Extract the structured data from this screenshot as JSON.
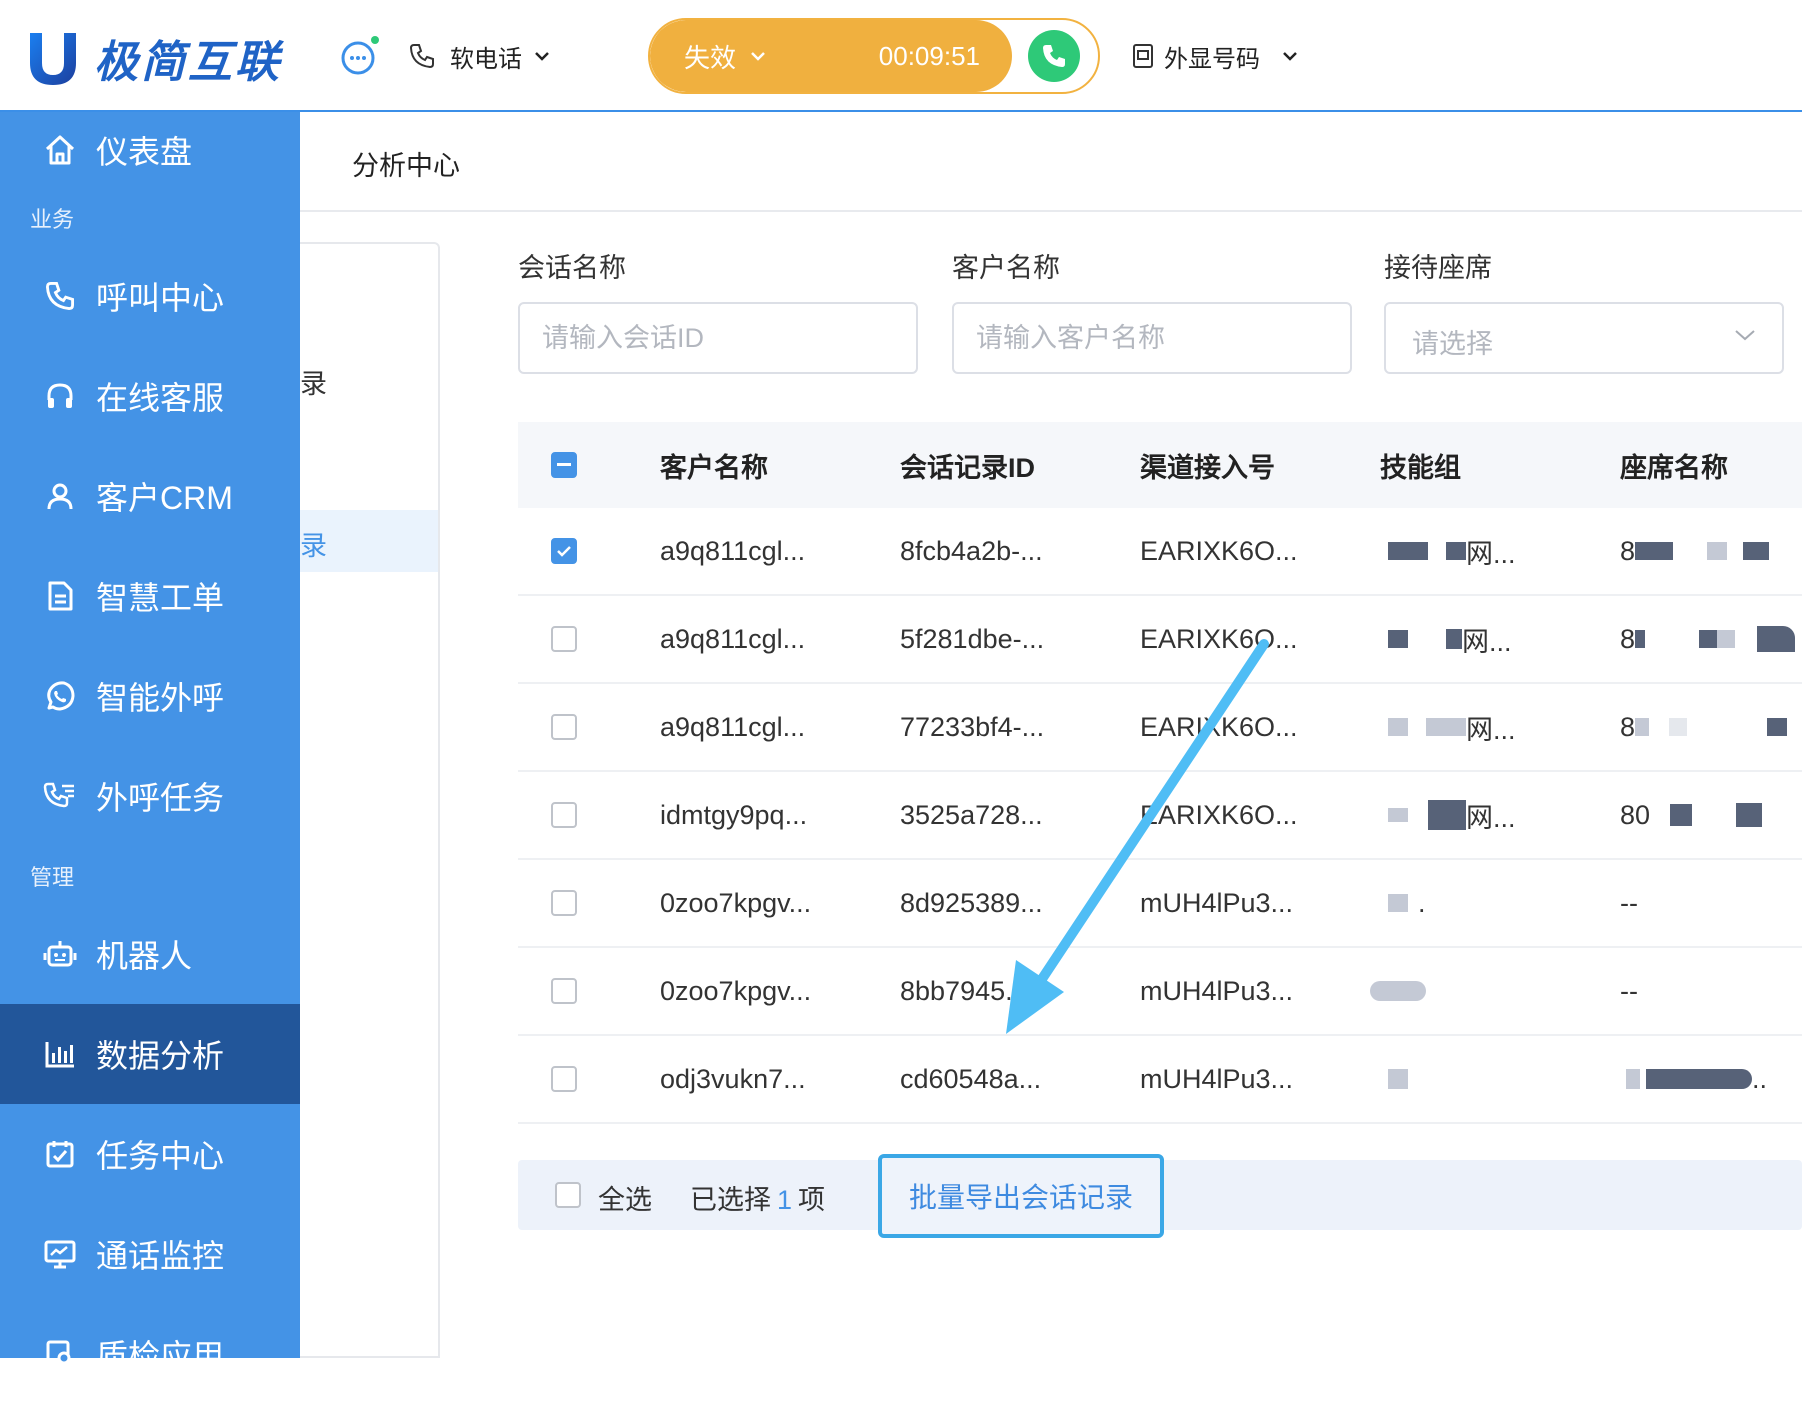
{
  "header": {
    "logo_text": "极简互联",
    "phone_mode": "软电话",
    "status": {
      "label": "失效",
      "timer": "00:09:51"
    },
    "caller_id": "外显号码"
  },
  "sidebar": {
    "top_item": {
      "label": "仪表盘",
      "icon": "home-icon"
    },
    "section_business": "业务",
    "business_items": [
      {
        "label": "呼叫中心",
        "icon": "phone-icon"
      },
      {
        "label": "在线客服",
        "icon": "headset-icon"
      },
      {
        "label": "客户CRM",
        "icon": "user-icon"
      },
      {
        "label": "智慧工单",
        "icon": "document-icon"
      },
      {
        "label": "智能外呼",
        "icon": "whatsapp-icon"
      },
      {
        "label": "外呼任务",
        "icon": "phone-list-icon"
      }
    ],
    "section_manage": "管理",
    "manage_items": [
      {
        "label": "机器人",
        "icon": "robot-icon"
      },
      {
        "label": "数据分析",
        "icon": "bar-chart-icon",
        "active": true
      },
      {
        "label": "任务中心",
        "icon": "calendar-check-icon"
      },
      {
        "label": "通话监控",
        "icon": "monitor-icon"
      },
      {
        "label": "质检应用",
        "icon": "inspect-icon"
      }
    ]
  },
  "page": {
    "title": "分析中心",
    "left_panel_fragment_1": "录",
    "left_panel_fragment_2": "录"
  },
  "filters": {
    "session": {
      "label": "会话名称",
      "placeholder": "请输入会话ID"
    },
    "customer": {
      "label": "客户名称",
      "placeholder": "请输入客户名称"
    },
    "agent": {
      "label": "接待座席",
      "placeholder": "请选择"
    }
  },
  "table": {
    "columns": [
      "客户名称",
      "会话记录ID",
      "渠道接入号",
      "技能组",
      "座席名称"
    ],
    "rows": [
      {
        "checked": true,
        "customer": "a9q811cgl...",
        "session_id": "8fcb4a2b-...",
        "channel": "EARIXK6O...",
        "skill": "网...",
        "agent": "8"
      },
      {
        "checked": false,
        "customer": "a9q811cgl...",
        "session_id": "5f281dbe-...",
        "channel": "EARIXK6O...",
        "skill": "网...",
        "agent": "8"
      },
      {
        "checked": false,
        "customer": "a9q811cgl...",
        "session_id": "77233bf4-...",
        "channel": "EARIXK6O...",
        "skill": "网...",
        "agent": "8"
      },
      {
        "checked": false,
        "customer": "idmtgy9pq...",
        "session_id": "3525a728...",
        "channel": "EARIXK6O...",
        "skill": "网...",
        "agent": "80"
      },
      {
        "checked": false,
        "customer": "0zoo7kpgv...",
        "session_id": "8d925389...",
        "channel": "mUH4lPu3...",
        "skill": ".",
        "agent": "--"
      },
      {
        "checked": false,
        "customer": "0zoo7kpgv...",
        "session_id": "8bb7945...",
        "channel": "mUH4lPu3...",
        "skill": "",
        "agent": "--"
      },
      {
        "checked": false,
        "customer": "odj3vukn7...",
        "session_id": "cd60548a...",
        "channel": "mUH4lPu3...",
        "skill": "",
        "agent": ".."
      }
    ]
  },
  "footer": {
    "select_all": "全选",
    "selected_prefix": "已选择",
    "selected_count": "1",
    "selected_suffix": "项",
    "export_button": "批量导出会话记录"
  },
  "colors": {
    "sidebar": "#4493e6",
    "sidebar_active": "#22569a",
    "status_pill": "#f0b03f",
    "call_button": "#2ec978",
    "annotation_arrow": "#4fbdf5"
  }
}
